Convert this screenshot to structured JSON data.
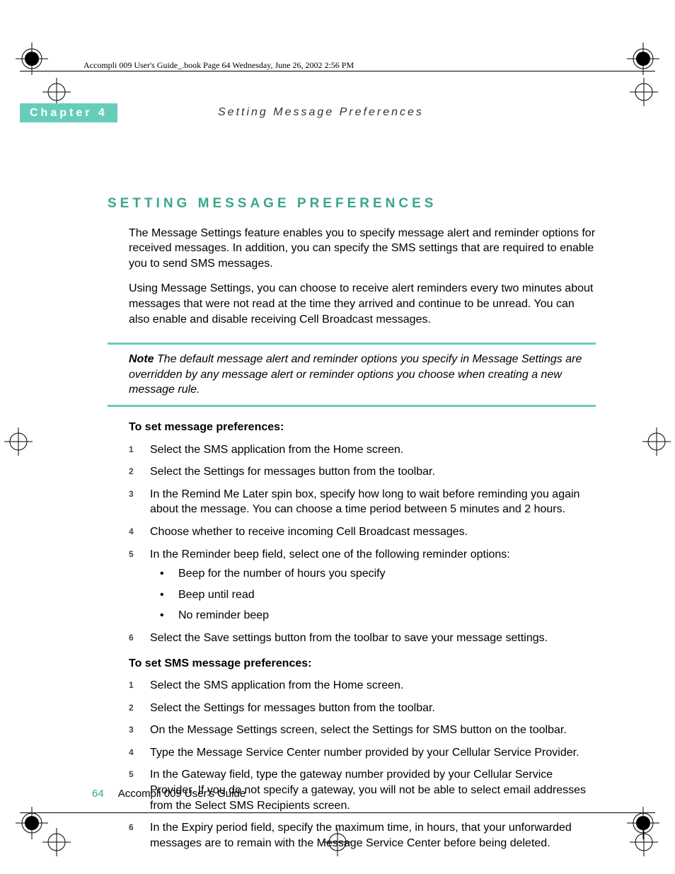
{
  "bookline": "Accompli 009 User's Guide_.book  Page 64  Wednesday, June 26, 2002  2:56 PM",
  "chapter": {
    "label": "Chapter 4",
    "title": "Setting Message Preferences"
  },
  "section_heading": "SETTING MESSAGE PREFERENCES",
  "intro": [
    "The Message Settings feature enables you to specify message alert and reminder options for received messages. In addition, you can specify the SMS settings that are required to enable you to send SMS messages.",
    "Using Message Settings, you can choose to receive alert reminders every two minutes about messages that were not read at the time they arrived and continue to be unread. You can also enable and disable receiving Cell Broadcast messages."
  ],
  "note": {
    "label": "Note",
    "text": "The default message alert and reminder options you specify in Message Settings are overridden by any message alert or reminder options you choose when creating a new message rule."
  },
  "procA": {
    "title": "To set message preferences:",
    "steps": [
      "Select the SMS application from the Home screen.",
      "Select the Settings for messages button from the toolbar.",
      "In the Remind Me Later spin box, specify how long to wait before reminding you again about the message. You can choose a time period between 5 minutes and 2 hours.",
      "Choose whether to receive incoming Cell Broadcast messages.",
      "In the Reminder beep field, select one of the following reminder options:",
      "Select the Save settings button from the toolbar to save your message settings."
    ],
    "step5_bullets": [
      "Beep for the number of hours you specify",
      "Beep until read",
      "No reminder beep"
    ]
  },
  "procB": {
    "title": "To set SMS message preferences:",
    "steps": [
      "Select the SMS application from the Home screen.",
      "Select the Settings for messages button from the toolbar.",
      "On the Message Settings screen, select the Settings for SMS button on the toolbar.",
      "Type the Message Service Center number provided by your Cellular Service Provider.",
      "In the Gateway field, type the gateway number provided by your Cellular Service Provider. If you do not specify a gateway, you will not be able to select email addresses from the Select SMS Recipients screen.",
      "In the Expiry period field, specify the maximum time, in hours, that your unforwarded messages are to remain with the Message Service Center before being deleted."
    ]
  },
  "footer": {
    "pageno": "64",
    "booktitle": "Accompli 009 User's Guide"
  }
}
